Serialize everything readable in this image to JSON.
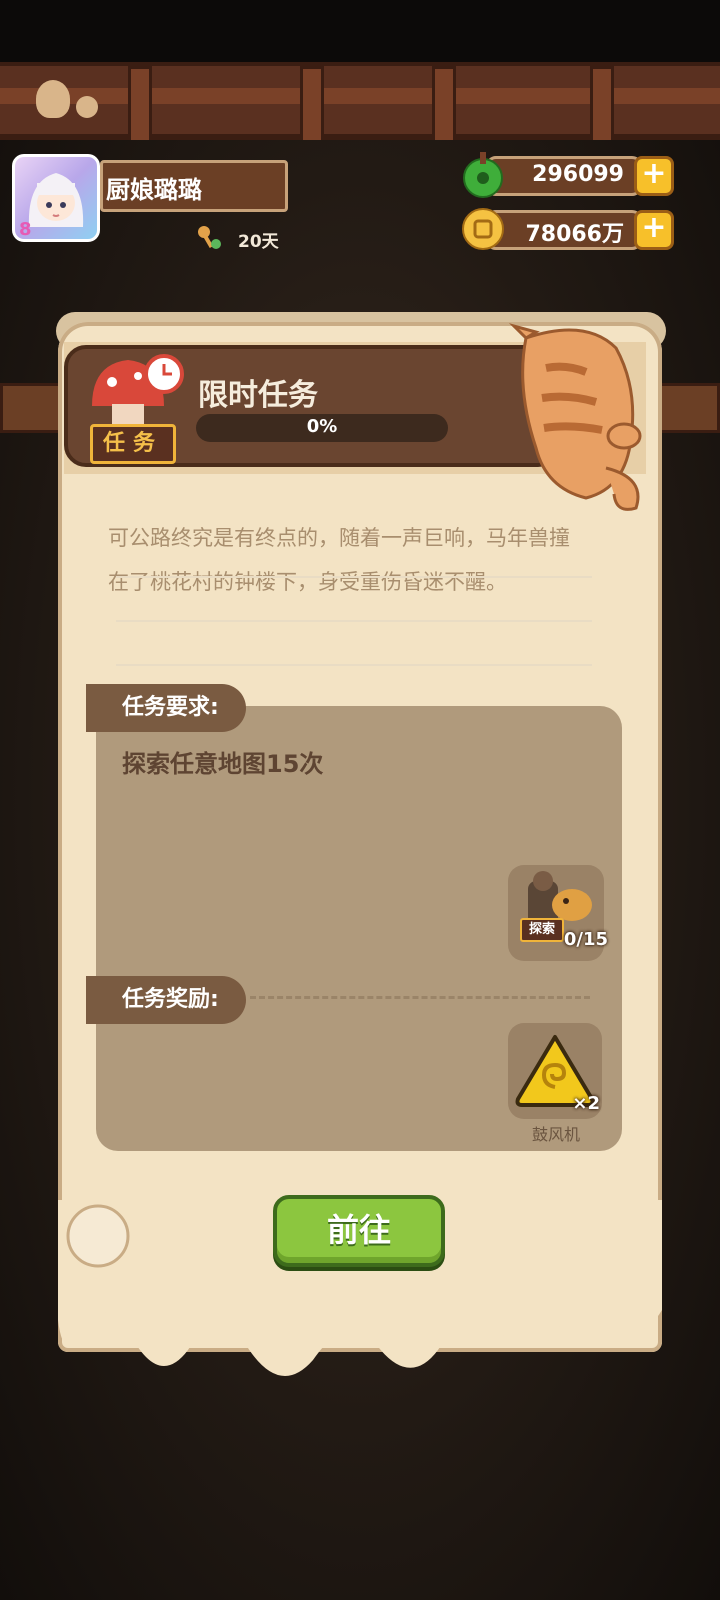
{
  "profile": {
    "name": "厨娘璐璐",
    "days": "20天"
  },
  "currencies": {
    "jade": "296099",
    "coins": "78066万"
  },
  "task": {
    "badge": "任务",
    "title": "限时任务",
    "progress_text": "0%",
    "progress_fraction": 0,
    "story_line1": "可公路终究是有终点的，随着一声巨响，马年兽撞",
    "story_line2": "在了桃花村的钟楼下，身受重伤昏迷不醒。",
    "requirement_label": "任务要求:",
    "requirement_text": "探索任意地图15次",
    "requirement_progress": "0/15",
    "requirement_icon_label": "探索",
    "reward_label": "任务奖励:",
    "reward_count": "×2",
    "reward_name": "鼓风机",
    "go_button": "前往"
  },
  "colors": {
    "accent_green": "#8cc63f",
    "gold": "#f7c02a",
    "wood": "#6b3f25",
    "parchment": "#f3e3c4"
  }
}
